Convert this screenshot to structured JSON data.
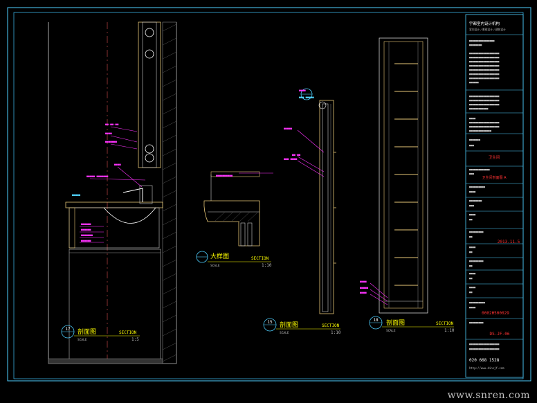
{
  "views": {
    "left_section": {
      "number": "17",
      "title": "剖面图",
      "label": "SECTION",
      "scale_label": "SCALE",
      "scale": "1:5"
    },
    "detail": {
      "number": "",
      "title": "大样图",
      "label": "SECTION",
      "scale_label": "SCALE",
      "scale": "1:10"
    },
    "mid_section": {
      "number": "15",
      "title": "剖面图",
      "label": "SECTION",
      "scale_label": "SCALE",
      "scale": "1:10"
    },
    "right_section": {
      "number": "18",
      "title": "剖面图",
      "label": "SECTION",
      "scale_label": "SCALE",
      "scale": "1:10"
    }
  },
  "title_block": {
    "company": "宇都室内设计机构",
    "company_sub": "室内设计 / 景观设计 / 建筑设计",
    "drawing_title_value": "卫生间",
    "plan_value": "卫生间剖面图 A",
    "date_value": "2013.11.5",
    "code_value": "0002H500029",
    "sheet_no": "DS-JF-06",
    "phone": "020 668 1528",
    "web": "http://www.dinsjf.com"
  },
  "watermark": "www.snren.com"
}
